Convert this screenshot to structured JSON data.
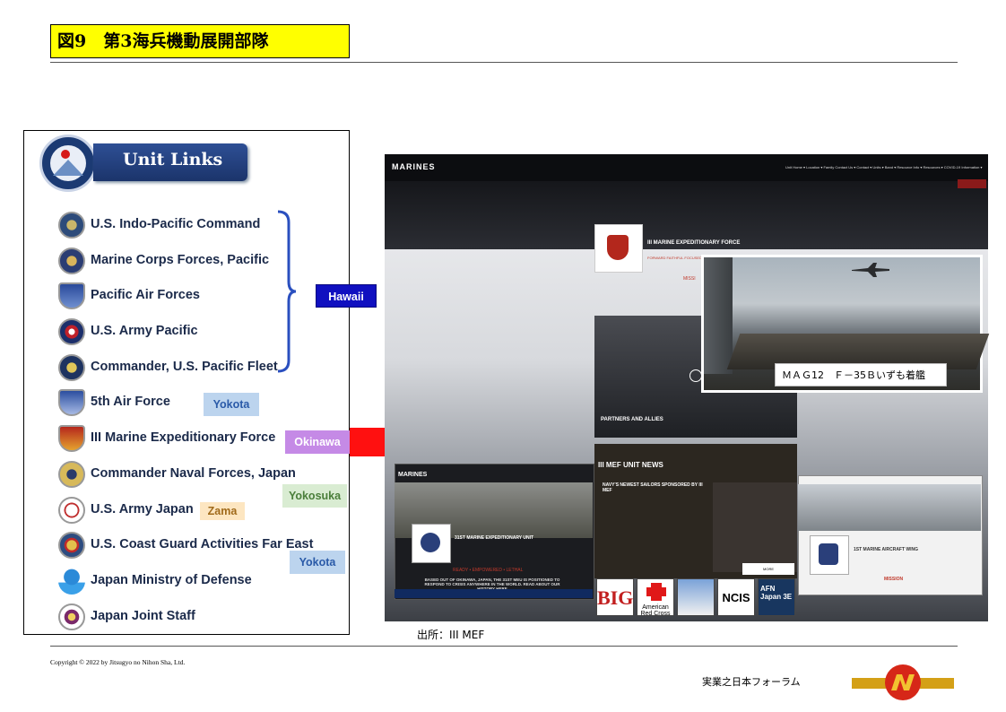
{
  "figure": {
    "title": "図9　第3海兵機動展開部隊"
  },
  "unit_links": {
    "banner_title": "Unit Links",
    "items": [
      {
        "label": "U.S. Indo-Pacific Command",
        "icon": "indopacom-seal-icon"
      },
      {
        "label": "Marine Corps Forces, Pacific",
        "icon": "marforpac-seal-icon"
      },
      {
        "label": "Pacific Air Forces",
        "icon": "pacaf-shield-icon"
      },
      {
        "label": "U.S. Army Pacific",
        "icon": "usarpac-seal-icon"
      },
      {
        "label": "Commander, U.S. Pacific Fleet",
        "icon": "pacflt-seal-icon"
      },
      {
        "label": "5th Air Force",
        "icon": "fifth-air-force-shield-icon"
      },
      {
        "label": "III Marine Expeditionary Force",
        "icon": "iii-mef-shield-icon"
      },
      {
        "label": "Commander Naval Forces, Japan",
        "icon": "cnfj-seal-icon"
      },
      {
        "label": "U.S. Army Japan",
        "icon": "usarj-seal-icon"
      },
      {
        "label": "U.S. Coast Guard Activities Far East",
        "icon": "uscg-far-east-seal-icon"
      },
      {
        "label": "Japan Ministry of Defense",
        "icon": "mod-japan-logo-icon"
      },
      {
        "label": "Japan Joint Staff",
        "icon": "joint-staff-seal-icon"
      }
    ],
    "locations": {
      "hawaii": "Hawaii",
      "yokota_1": "Yokota",
      "okinawa": "Okinawa",
      "yokosuka": "Yokosuka",
      "zama": "Zama",
      "yokota_2": "Yokota"
    }
  },
  "website": {
    "logo": "MARINES",
    "nav_items": "Unit Home ▾   Location ▾   Family   Contact Us ▾   Contact ▾   Units ▾   Band ▾   Resource Info ▾   Resources ▾   COVID-19 Information ▾",
    "heading": "III MARINE EXPEDITIONARY FORCE",
    "motto": "FORWARD  FAITHFUL  FOCUSED",
    "mission": "MISSI",
    "partners_label": "PARTNERS AND ALLIES",
    "news_title": "III MEF UNIT NEWS",
    "news_headline": "NAVY'S NEWEST SAILORS SPONSORED BY III MEF",
    "more_button": "MORE",
    "meu": {
      "nav_logo": "MARINES",
      "heading": "31ST MARINE EXPEDITIONARY UNIT",
      "tagline": "READY • EMPOWERED • LETHAL",
      "text": "BASED OUT OF OKINAWA, JAPAN, THE 31ST MEU IS POSITIONED TO RESPOND TO CRISIS ANYWHERE IN THE WORLD. READ ABOUT OUR HISTORY HERE"
    },
    "wing": {
      "heading": "1ST MARINE AIRCRAFT WING",
      "mission": "MISSION"
    },
    "photo_caption": "ＭＡＧ12　Ｆ－35Ｂいずも着艦",
    "logo_tiles": [
      "BIG",
      "American Red Cross",
      "",
      "NCIS",
      "AFN Japan 3E"
    ]
  },
  "source": "出所：III MEF",
  "footer": {
    "copyright": "Copyright © 2022 by Jitsugyo no Nihon Sha, Ltd.",
    "forum": "実業之日本フォーラム"
  }
}
